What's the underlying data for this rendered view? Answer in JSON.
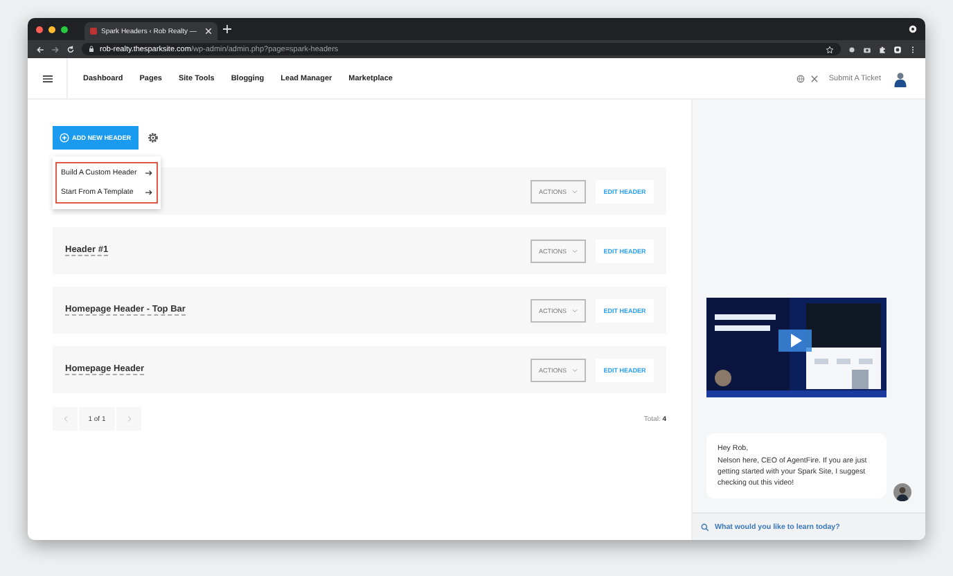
{
  "browser": {
    "tab_title": "Spark Headers ‹ Rob Realty —",
    "url_host": "rob-realty.thesparksite.com",
    "url_path": "/wp-admin/admin.php?page=spark-headers"
  },
  "nav": {
    "items": [
      "Dashboard",
      "Pages",
      "Site Tools",
      "Blogging",
      "Lead Manager",
      "Marketplace"
    ],
    "ticket": "Submit A Ticket"
  },
  "toolbar": {
    "add_button": "ADD NEW HEADER"
  },
  "dropdown": [
    "Build A Custom Header",
    "Start From A Template"
  ],
  "headers": [
    {
      "actions": "ACTIONS",
      "edit": "EDIT HEADER"
    },
    {
      "name": "Header #1",
      "actions": "ACTIONS",
      "edit": "EDIT HEADER"
    },
    {
      "name": "Homepage Header - Top Bar",
      "actions": "ACTIONS",
      "edit": "EDIT HEADER"
    },
    {
      "name": "Homepage Header",
      "actions": "ACTIONS",
      "edit": "EDIT HEADER"
    }
  ],
  "pagination": {
    "page": "1 of 1"
  },
  "total": {
    "label": "Total:",
    "count": "4"
  },
  "sidebar": {
    "message": {
      "greeting": "Hey Rob,",
      "body": "Nelson here, CEO of AgentFire. If you are just getting started with your Spark Site, I suggest checking out this video!"
    },
    "search": {
      "placeholder": "What would you like to learn today?"
    }
  }
}
